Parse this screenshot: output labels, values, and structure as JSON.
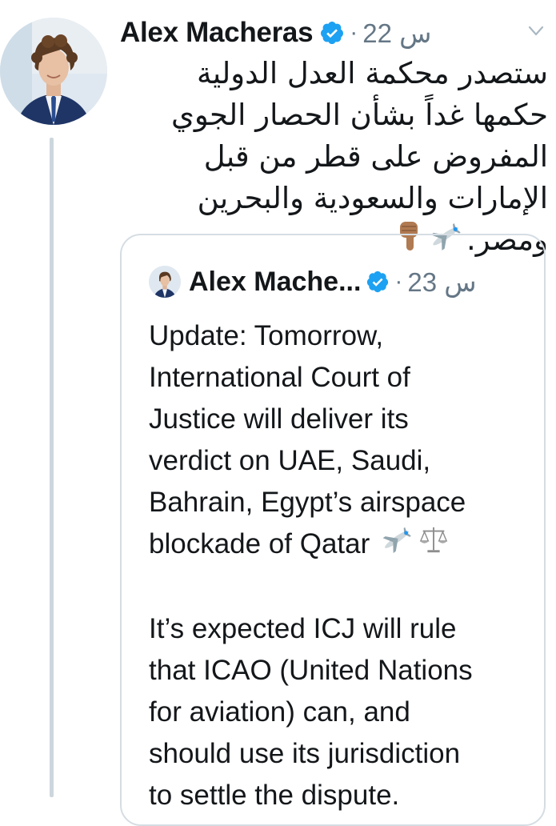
{
  "tweet": {
    "author_name": "Alex Macheras",
    "time": "22 س",
    "dot": "·",
    "text": "ستصدر محكمة العدل الدولية حكمها غداً بشأن الحصار الجوي المفروض على قطر من قبل الإمارات والسعودية والبحرين ومصر.",
    "emojis": [
      "airplane-emoji",
      "pointing-down-emoji"
    ]
  },
  "quoted_tweet": {
    "author_name": "Alex Mache...",
    "time": "23 س",
    "dot": "·",
    "paragraph_1": "Update: Tomorrow,\nInternational Court of\nJustice will deliver its\nverdict on UAE, Saudi,\nBahrain, Egypt’s airspace\nblockade of Qatar",
    "paragraph_1_emojis": [
      "airplane-emoji",
      "scales-emoji"
    ],
    "paragraph_2": "It’s expected ICJ will rule\nthat ICAO (United Nations\nfor aviation) can, and\nshould use its jurisdiction\nto settle the dispute."
  },
  "colors": {
    "text": "#14171a",
    "secondary": "#657786",
    "verified_blue": "#1da1f2",
    "border": "#d5dde3",
    "thread_line": "#ccd6dd"
  },
  "icons": [
    "verified-badge-icon",
    "chevron-down-icon",
    "airplane-emoji",
    "pointing-down-emoji",
    "scales-emoji"
  ]
}
